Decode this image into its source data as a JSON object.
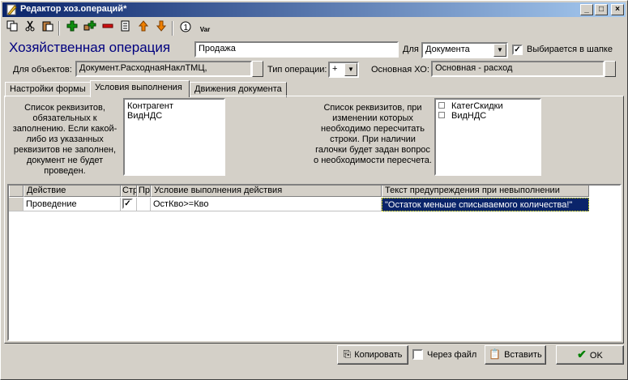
{
  "window": {
    "title": "Редактор хоз.операций*",
    "controls": {
      "minimize": "_",
      "maximize": "□",
      "close": "×"
    }
  },
  "toolbar": {
    "icons": [
      "copy-icon",
      "cut-icon",
      "paste-icon",
      "add-icon",
      "add-child-icon",
      "delete-icon",
      "edit-icon",
      "move-up-icon",
      "move-down-icon",
      "number-icon",
      "var-icon"
    ],
    "var_text": "Var"
  },
  "header": {
    "title": "Хозяйственная операция",
    "name_value": "Продажа",
    "for_label": "Для",
    "for_value": "Документа",
    "selected_in_cap_label": "Выбирается в шапке",
    "selected_in_cap_checked": true
  },
  "row2": {
    "objects_label": "Для объектов:",
    "objects_value": "Документ.РасходнаяНаклТМЦ,",
    "op_type_label": "Тип операции:",
    "op_type_value": "+",
    "main_xo_label": "Основная ХО:",
    "main_xo_value": "Основная - расход"
  },
  "tabs": [
    {
      "label": "Настройки формы"
    },
    {
      "label": "Условия выполнения"
    },
    {
      "label": "Движения документа"
    }
  ],
  "conditions": {
    "required_desc": "Список реквизитов, обязательных к заполнению. Если какой-либо из указанных реквизитов не заполнен, документ не будет проведен.",
    "required_items": [
      "Контрагент",
      "ВидНДС"
    ],
    "recalc_desc": "Список реквизитов, при изменении которых необходимо пересчитать строки. При наличии галочки будет задан вопрос о необходимости пересчета.",
    "recalc_items": [
      "КатегСкидки",
      "ВидНДС"
    ]
  },
  "grid": {
    "columns": [
      "Действие",
      "Стр",
      "Пр",
      "Условие выполнения действия",
      "Текст предупреждения при невыполнении"
    ],
    "rows": [
      {
        "action": "Проведение",
        "str_checked": true,
        "pr_checked": false,
        "condition": "ОстКво>=Кво",
        "warning": "\"Остаток меньше списываемого количества!\""
      }
    ]
  },
  "footer": {
    "copy_label": "Копировать",
    "via_file_label": "Через файл",
    "via_file_checked": false,
    "paste_label": "Вставить",
    "ok_label": "OK"
  },
  "colors": {
    "title_blue": "#00007f",
    "selection": "#0a246a",
    "ok_check": "#008000"
  }
}
